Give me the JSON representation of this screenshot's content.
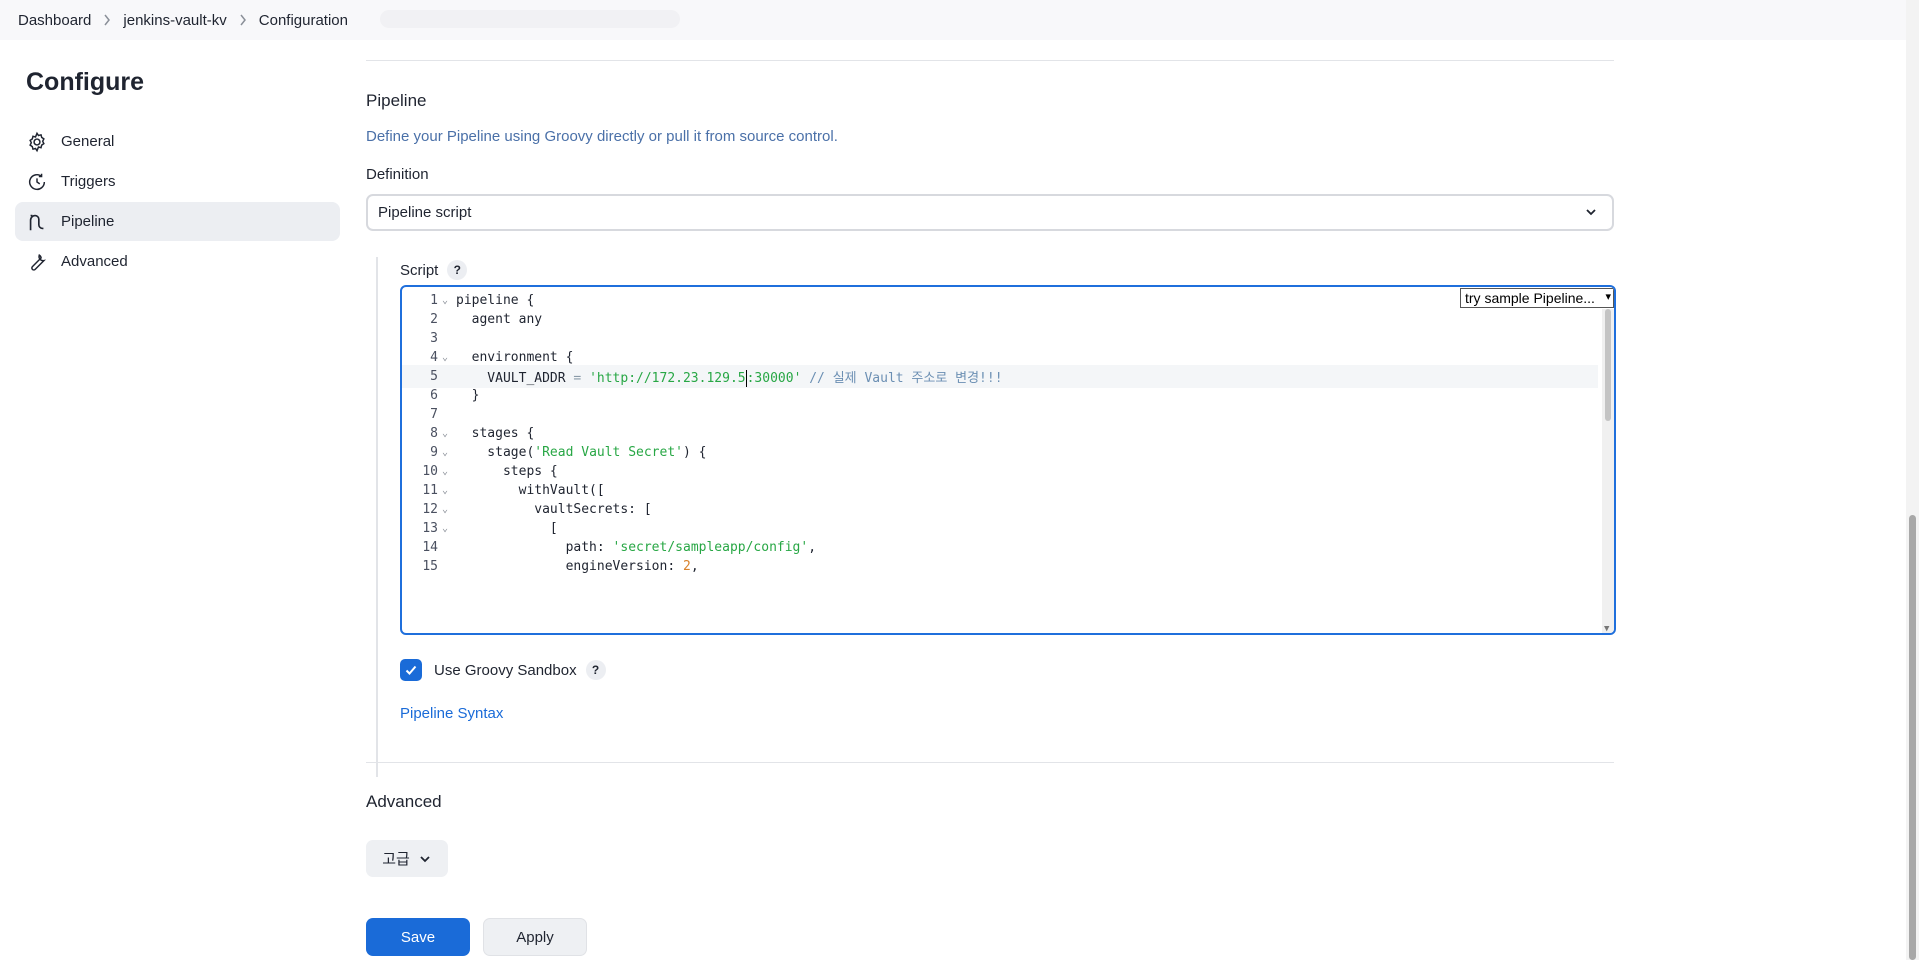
{
  "breadcrumb": [
    "Dashboard",
    "jenkins-vault-kv",
    "Configuration"
  ],
  "sidebar": {
    "title": "Configure",
    "items": [
      {
        "label": "General",
        "icon": "gear-icon"
      },
      {
        "label": "Triggers",
        "icon": "clock-icon"
      },
      {
        "label": "Pipeline",
        "icon": "pipeline-icon",
        "active": true
      },
      {
        "label": "Advanced",
        "icon": "wrench-icon"
      }
    ]
  },
  "pipeline": {
    "title": "Pipeline",
    "description": "Define your Pipeline using Groovy directly or pull it from source control.",
    "definition_label": "Definition",
    "definition_value": "Pipeline script",
    "script_label": "Script",
    "sample_select": "try sample Pipeline...",
    "sandbox_label": "Use Groovy Sandbox",
    "sandbox_checked": true,
    "syntax_link": "Pipeline Syntax",
    "code_lines": [
      {
        "n": "1",
        "fold": true,
        "text": "pipeline {"
      },
      {
        "n": "2",
        "fold": false,
        "text": "  agent any"
      },
      {
        "n": "3",
        "fold": false,
        "text": ""
      },
      {
        "n": "4",
        "fold": true,
        "text": "  environment {"
      },
      {
        "n": "5",
        "fold": false,
        "text": "    VAULT_ADDR = 'http://172.23.129.5:30000' // 실제 Vault 주소로 변경!!!"
      },
      {
        "n": "6",
        "fold": false,
        "text": "  }"
      },
      {
        "n": "7",
        "fold": false,
        "text": ""
      },
      {
        "n": "8",
        "fold": true,
        "text": "  stages {"
      },
      {
        "n": "9",
        "fold": true,
        "text": "    stage('Read Vault Secret') {"
      },
      {
        "n": "10",
        "fold": true,
        "text": "      steps {"
      },
      {
        "n": "11",
        "fold": true,
        "text": "        withVault(["
      },
      {
        "n": "12",
        "fold": true,
        "text": "          vaultSecrets: ["
      },
      {
        "n": "13",
        "fold": true,
        "text": "            ["
      },
      {
        "n": "14",
        "fold": false,
        "text": "              path: 'secret/sampleapp/config',"
      },
      {
        "n": "15",
        "fold": false,
        "text": "              engineVersion: 2,"
      }
    ]
  },
  "advanced": {
    "title": "Advanced",
    "button_label": "고급"
  },
  "actions": {
    "save_label": "Save",
    "apply_label": "Apply"
  },
  "colors": {
    "accent": "#1a6bd8",
    "string": "#28a745",
    "number": "#d9822b",
    "comment": "#6b8fb3"
  }
}
